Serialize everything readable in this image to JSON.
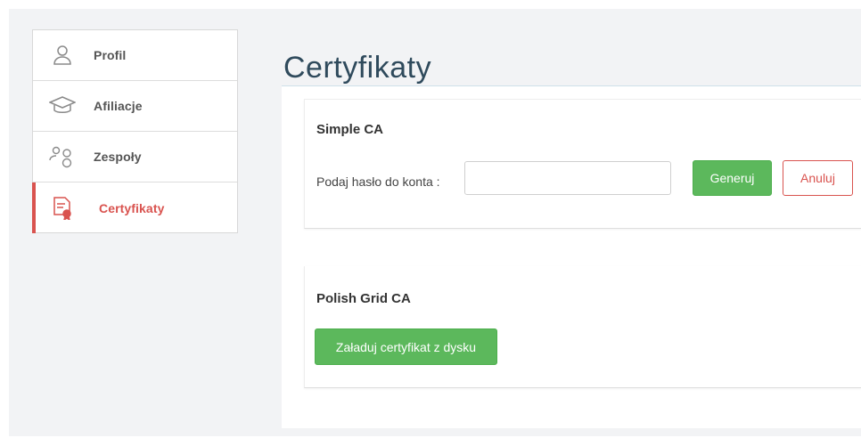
{
  "sidebar": {
    "items": [
      {
        "label": "Profil",
        "icon": "user-icon"
      },
      {
        "label": "Afiliacje",
        "icon": "graduation-cap-icon"
      },
      {
        "label": "Zespoły",
        "icon": "team-icon"
      },
      {
        "label": "Certyfikaty",
        "icon": "certificate-icon",
        "active": true
      }
    ]
  },
  "page": {
    "title": "Certyfikaty"
  },
  "simple_ca": {
    "title": "Simple CA",
    "password_label": "Podaj hasło do konta :",
    "password_value": "",
    "generate_label": "Generuj",
    "cancel_label": "Anuluj"
  },
  "polish_grid_ca": {
    "title": "Polish Grid CA",
    "upload_label": "Załaduj certyfikat z dysku"
  },
  "colors": {
    "accent_red": "#d9534f",
    "success_green": "#5cb85c",
    "title_color": "#2f4a5c"
  }
}
